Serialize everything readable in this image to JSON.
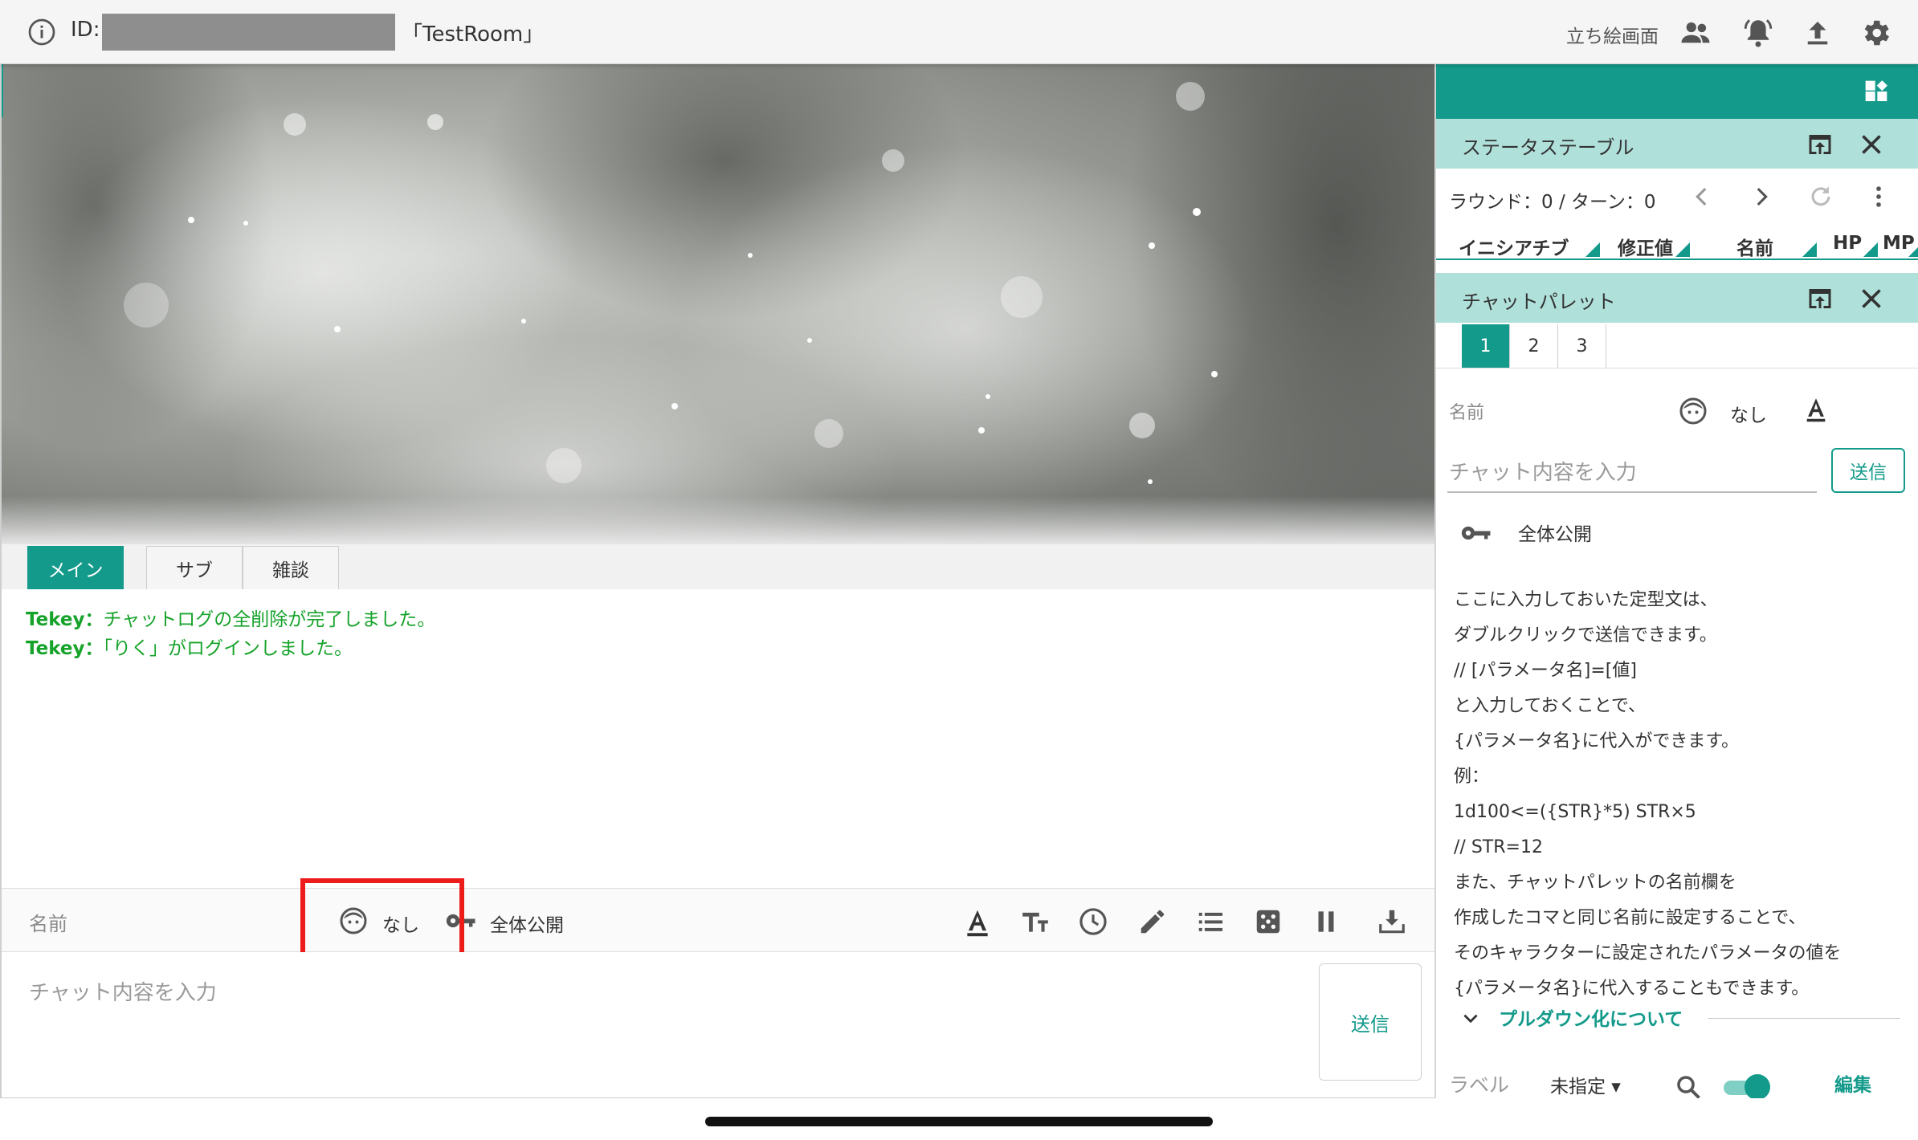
{
  "topbar": {
    "id_label": "ID:",
    "room_name": "「TestRoom」",
    "stand_label": "立ち絵画面"
  },
  "tabs": [
    {
      "label": "メイン",
      "active": true
    },
    {
      "label": "サブ",
      "active": false
    },
    {
      "label": "雑談",
      "active": false
    }
  ],
  "chatlog": [
    {
      "sender": "Tekey：",
      "message": "チャットログの全削除が完了しました。"
    },
    {
      "sender": "Tekey：",
      "message": "「りく」がログインしました。"
    }
  ],
  "input": {
    "name_placeholder": "名前",
    "character": "なし",
    "visibility": "全体公開",
    "chat_placeholder": "チャット内容を入力",
    "send_label": "送信"
  },
  "status_table": {
    "title": "ステータステーブル",
    "round_text": "ラウンド：0 / ターン：0",
    "columns": [
      "イニシアチブ",
      "修正値",
      "名前",
      "HP",
      "MP"
    ]
  },
  "chat_palette": {
    "title": "チャットパレット",
    "tabs": [
      "1",
      "2",
      "3"
    ],
    "name_placeholder": "名前",
    "character": "なし",
    "chat_placeholder": "チャット内容を入力",
    "send_label": "送信",
    "visibility": "全体公開",
    "lines": [
      "ここに入力しておいた定型文は、",
      "ダブルクリックで送信できます。",
      "// [パラメータ名]=[値]",
      "と入力しておくことで、",
      "{パラメータ名}に代入ができます。",
      "例：",
      "1d100<=({STR}*5) STR×5",
      "// STR=12",
      "また、チャットパレットの名前欄を",
      "作成したコマと同じ名前に設定することで、",
      "そのキャラクターに設定されたパラメータの値を",
      "{パラメータ名}に代入することもできます。"
    ],
    "pulldown_label": "プルダウン化について",
    "label_placeholder": "ラベル",
    "label_value": "未指定",
    "edit_label": "編集"
  },
  "colors": {
    "accent": "#139a8b",
    "panel_title_bg": "#b0e0da",
    "log_text": "#16a32a",
    "highlight": "#ee1b1b"
  },
  "icons": [
    "info-icon",
    "people-icon",
    "bell-icon",
    "upload-icon",
    "gear-icon",
    "dock-icon",
    "popout-icon",
    "close-icon",
    "chevron-left-icon",
    "chevron-right-icon",
    "refresh-icon",
    "more-vert-icon",
    "face-icon",
    "key-icon",
    "font-color-icon",
    "font-size-icon",
    "clock-icon",
    "pencil-icon",
    "list-icon",
    "dice-icon",
    "pause-icon",
    "download-icon",
    "search-icon",
    "chevron-down-icon"
  ]
}
